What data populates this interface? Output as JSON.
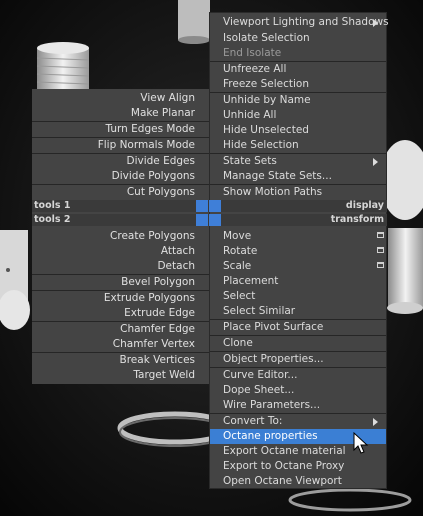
{
  "left_menu": {
    "items": [
      {
        "label": "View Align"
      },
      {
        "label": "Make Planar"
      },
      {
        "label": "Turn Edges Mode"
      },
      {
        "label": "Flip Normals Mode"
      },
      {
        "label": "Divide Edges"
      },
      {
        "label": "Divide Polygons"
      },
      {
        "label": "Cut Polygons"
      },
      {
        "label": "Create Polygons"
      },
      {
        "label": "Attach"
      },
      {
        "label": "Detach"
      },
      {
        "label": "Bevel Polygon"
      },
      {
        "label": "Extrude Polygons"
      },
      {
        "label": "Extrude Edge"
      },
      {
        "label": "Chamfer Edge"
      },
      {
        "label": "Chamfer Vertex"
      },
      {
        "label": "Break Vertices"
      },
      {
        "label": "Target Weld"
      }
    ]
  },
  "quad_headers": {
    "tools1": "tools 1",
    "display": "display",
    "tools2": "tools 2",
    "transform": "transform"
  },
  "right_menu": {
    "items": [
      {
        "label": "Viewport Lighting and Shadows"
      },
      {
        "label": "Isolate Selection"
      },
      {
        "label": "End Isolate"
      },
      {
        "label": "Unfreeze All"
      },
      {
        "label": "Freeze Selection"
      },
      {
        "label": "Unhide by Name"
      },
      {
        "label": "Unhide All"
      },
      {
        "label": "Hide Unselected"
      },
      {
        "label": "Hide Selection"
      },
      {
        "label": "State Sets"
      },
      {
        "label": "Manage State Sets..."
      },
      {
        "label": "Show Motion Paths"
      },
      {
        "label": "Move"
      },
      {
        "label": "Rotate"
      },
      {
        "label": "Scale"
      },
      {
        "label": "Placement"
      },
      {
        "label": "Select"
      },
      {
        "label": "Select Similar"
      },
      {
        "label": "Place Pivot Surface"
      },
      {
        "label": "Clone"
      },
      {
        "label": "Object Properties..."
      },
      {
        "label": "Curve Editor..."
      },
      {
        "label": "Dope Sheet..."
      },
      {
        "label": "Wire Parameters..."
      },
      {
        "label": "Convert To:"
      },
      {
        "label": "Octane properties"
      },
      {
        "label": "Export Octane material"
      },
      {
        "label": "Export to Octane Proxy"
      },
      {
        "label": "Open Octane Viewport"
      }
    ]
  },
  "colors": {
    "menu_bg": "#444444",
    "highlight": "#3b7fd4",
    "quad_square": "#3f7fd8"
  }
}
